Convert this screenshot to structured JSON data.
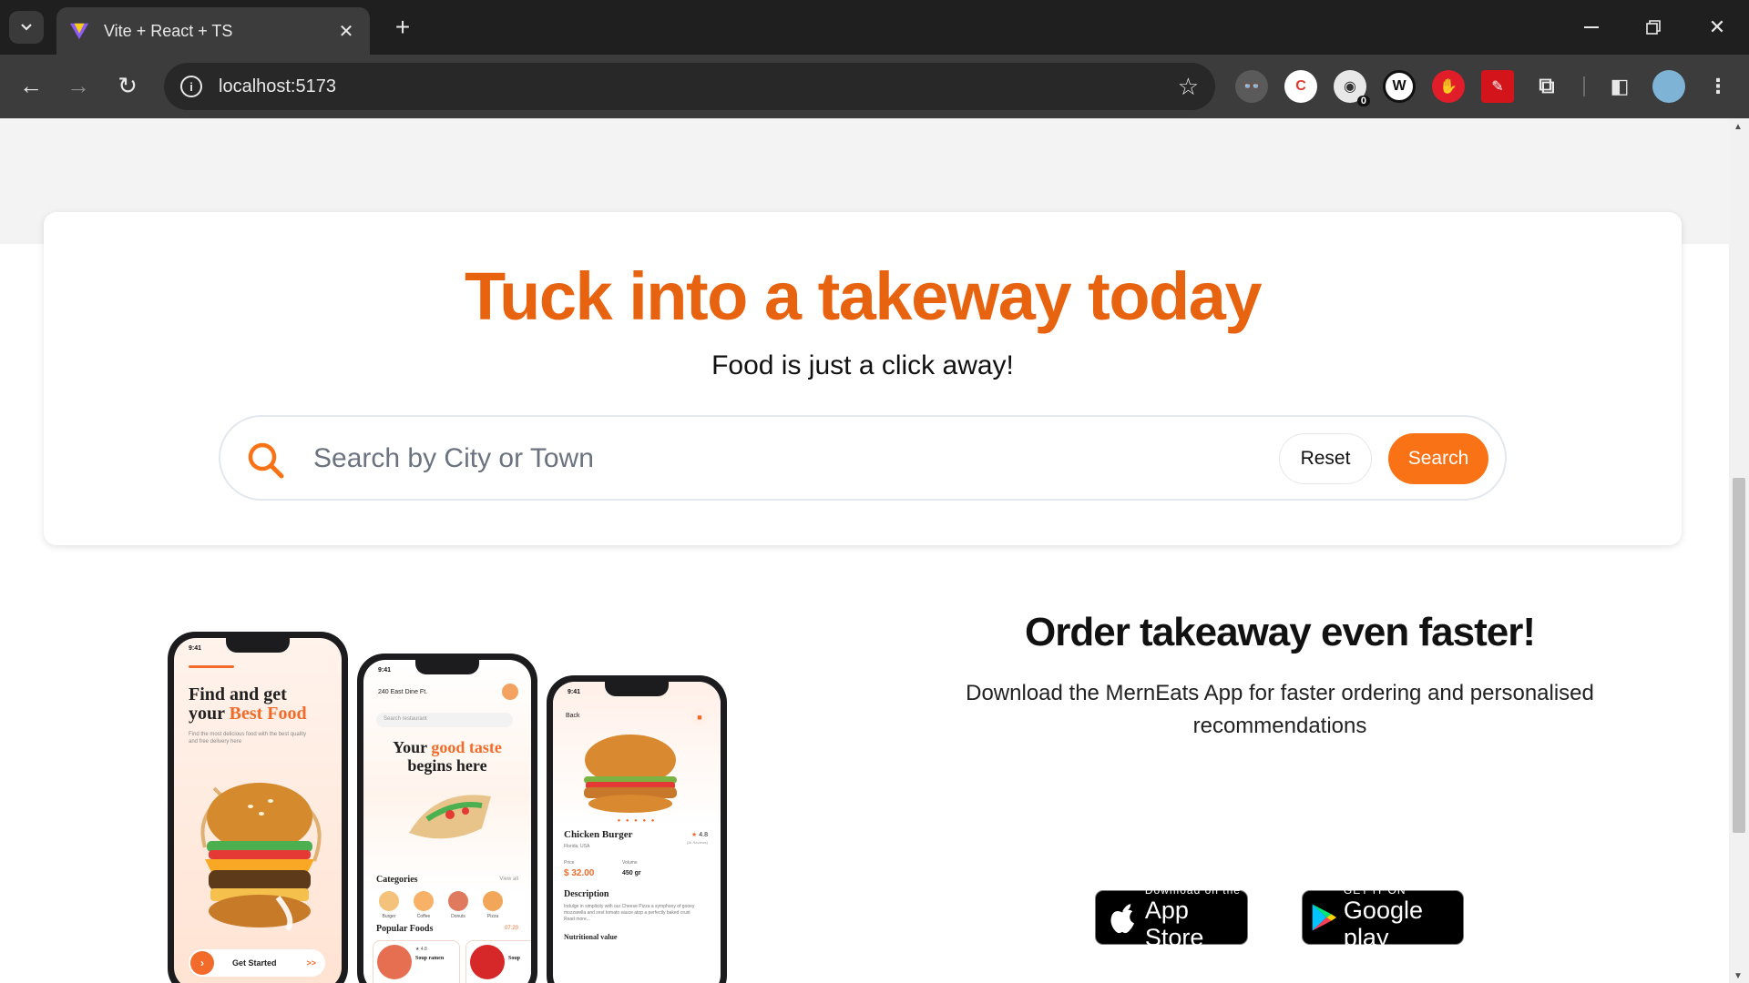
{
  "browser": {
    "tab_title": "Vite + React + TS",
    "url": "localhost:5173",
    "extension_badge_count": "0"
  },
  "hero": {
    "title": "Tuck into a takeway today",
    "subtitle": "Food is just a click away!",
    "search_placeholder": "Search by City or Town",
    "reset_label": "Reset",
    "search_label": "Search"
  },
  "app_promo": {
    "title": "Order takeaway even faster!",
    "subtitle": "Download the MernEats App for faster ordering and personalised recommendations",
    "app_store": {
      "small": "Download on the",
      "big": "App Store"
    },
    "google_play": {
      "small": "GET IT ON",
      "big": "Google play"
    }
  },
  "phones": {
    "p1": {
      "time": "9:41",
      "title_line1": "Find and get",
      "title_line2_plain": "your ",
      "title_line2_accent": "Best Food",
      "description": "Find the most delicious food with the best quality and free delivery here",
      "button": "Get Started",
      "button_arrows": ">>"
    },
    "p2": {
      "time": "9:41",
      "location": "240 East Dine Ft.",
      "search_placeholder": "Search restaurant",
      "head_plain1": "Your ",
      "head_accent": "good taste",
      "head_line2": "begins here",
      "categories_label": "Categories",
      "view_all": "View all",
      "categories": [
        "Burger",
        "Coffee",
        "Donuts",
        "Pizza"
      ],
      "popular_label": "Popular Foods",
      "popular_time": "07:20",
      "card1_rating": "★ 4.8",
      "card1_name": "Soup ramen",
      "card2_name": "Soup"
    },
    "p3": {
      "time": "9:41",
      "back": "Back",
      "name": "Chicken Burger",
      "rating": "4.8",
      "reviews": "(2k Reviews)",
      "location": "Florida, USA",
      "price_label": "Price",
      "price": "$ 32.00",
      "volume_label": "Volume",
      "volume": "450 gr",
      "description_label": "Description",
      "description": "Indulge in simplicity with our Cheese Pizza a symphony of gooey mozzarella and zest tomato sauce atop a perfectly baked crust Read more...",
      "nutrition_label": "Nutritional value"
    }
  },
  "colors": {
    "accent": "#e8630f",
    "button": "#f97316"
  }
}
